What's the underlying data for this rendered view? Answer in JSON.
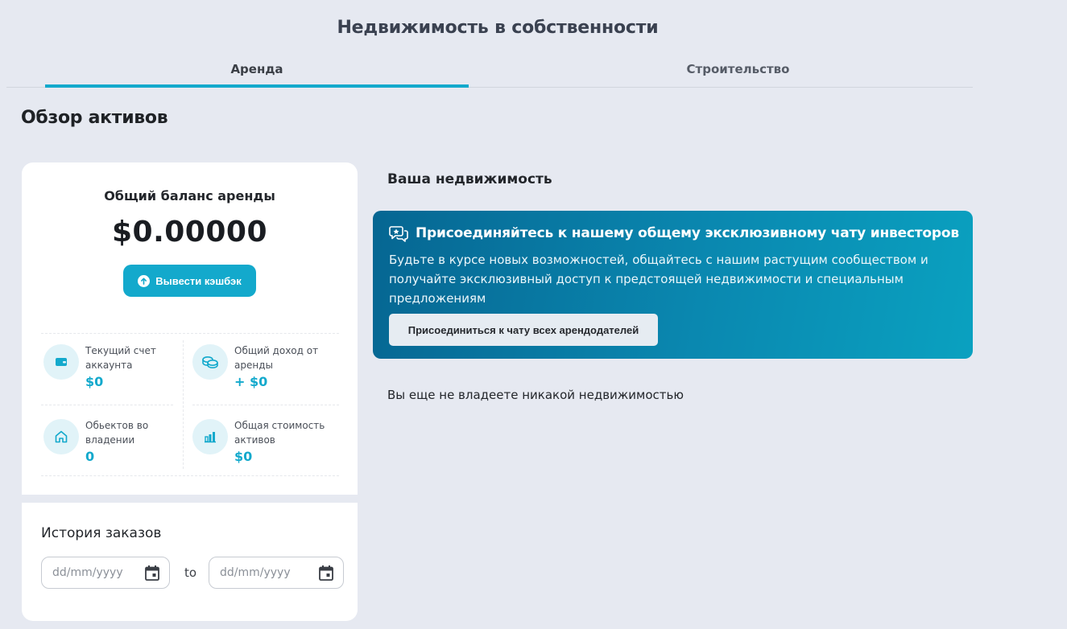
{
  "header": {
    "title": "Недвижимость в собственности"
  },
  "tabs": [
    {
      "label": "Аренда",
      "active": true
    },
    {
      "label": "Строительство",
      "active": false
    }
  ],
  "overview": {
    "title": "Обзор активов"
  },
  "balance": {
    "label": "Общий баланс аренды",
    "value": "$0.00000",
    "withdraw_label": "Вывести кэшбэк"
  },
  "stats": [
    {
      "icon": "wallet-icon",
      "label": "Текущий счет аккаунта",
      "value": "$0"
    },
    {
      "icon": "coins-icon",
      "label": "Общий доход от аренды",
      "value": "+ $0"
    },
    {
      "icon": "home-icon",
      "label": "Обьектов во владении",
      "value": "0"
    },
    {
      "icon": "chart-icon",
      "label": "Общая стоимость активов",
      "value": "$0"
    }
  ],
  "orders": {
    "title": "История заказов",
    "from_placeholder": "dd/mm/yyyy",
    "to_label": "to",
    "to_placeholder": "dd/mm/yyyy"
  },
  "properties": {
    "title": "Ваша недвижимость",
    "empty_message": "Вы еще не владеете никакой недвижимостью"
  },
  "chat_banner": {
    "icon": "chat-star-icon",
    "title": "Присоединяйтесь к нашему общему эксклюзивному чату инвесторов",
    "text": "Будьте в курсе новых возможностей, общайтесь с нашим растущим сообществом и получайте эксклюзивный доступ к предстоящей недвижимости и специальным предложениям",
    "button_label": "Присоединиться к чату всех арендодателей"
  },
  "colors": {
    "accent": "#13a9cc",
    "background": "#e6e9f1",
    "banner_start": "#066692",
    "banner_end": "#0aa1c0"
  }
}
